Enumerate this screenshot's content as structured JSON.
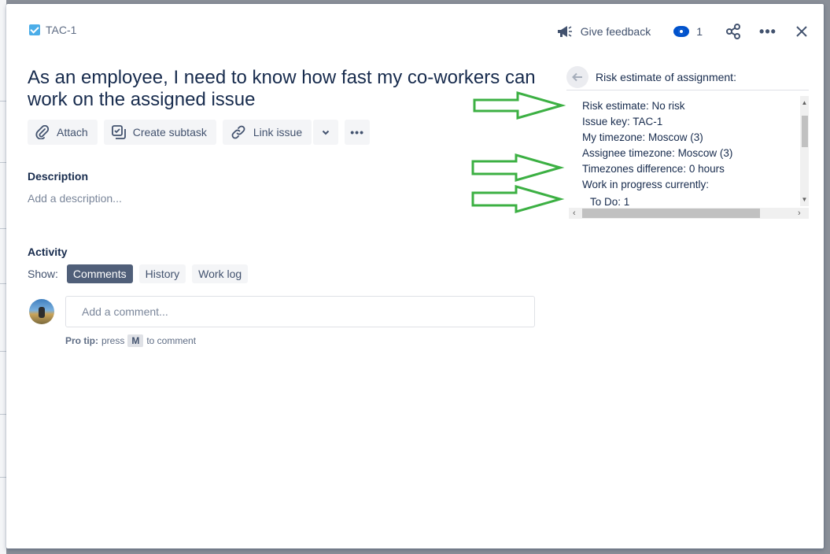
{
  "issue": {
    "key": "TAC-1",
    "title": "As an employee, I need to know how fast my co-workers can work on the assigned issue"
  },
  "header": {
    "feedback_label": "Give feedback",
    "watch_count": "1"
  },
  "toolbar": {
    "attach": "Attach",
    "create_subtask": "Create subtask",
    "link_issue": "Link issue"
  },
  "description": {
    "heading": "Description",
    "placeholder": "Add a description..."
  },
  "activity": {
    "heading": "Activity",
    "show_label": "Show:",
    "tabs": [
      "Comments",
      "History",
      "Work log"
    ],
    "active_tab": "Comments"
  },
  "comment": {
    "placeholder": "Add a comment...",
    "protip_label": "Pro tip:",
    "protip_pre": "press",
    "protip_key": "M",
    "protip_post": "to comment"
  },
  "panel": {
    "title": "Risk estimate of assignment:",
    "lines": [
      "Risk estimate: No risk",
      "Issue key: TAC-1",
      "My timezone: Moscow (3)",
      "Assignee timezone: Moscow (3)",
      "Timezones difference: 0 hours",
      "Work in progress currently:",
      "To Do: 1"
    ]
  },
  "colors": {
    "arrow_green": "#3cb043",
    "brand_blue": "#0052cc",
    "active_tab_bg": "#505f79"
  },
  "icons": [
    "task-icon",
    "megaphone-icon",
    "eye-icon",
    "share-icon",
    "more-icon",
    "close-icon",
    "paperclip-icon",
    "subtask-icon",
    "link-icon",
    "chevron-down-icon",
    "back-arrow-icon"
  ]
}
